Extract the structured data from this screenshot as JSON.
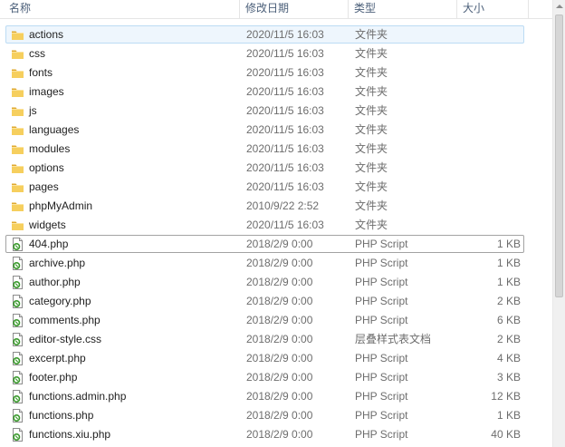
{
  "columns": {
    "name": "名称",
    "date": "修改日期",
    "type": "类型",
    "size": "大小"
  },
  "rows": [
    {
      "name": "actions",
      "date": "2020/11/5 16:03",
      "type": "文件夹",
      "size": "",
      "kind": "folder",
      "state": "selected"
    },
    {
      "name": "css",
      "date": "2020/11/5 16:03",
      "type": "文件夹",
      "size": "",
      "kind": "folder"
    },
    {
      "name": "fonts",
      "date": "2020/11/5 16:03",
      "type": "文件夹",
      "size": "",
      "kind": "folder"
    },
    {
      "name": "images",
      "date": "2020/11/5 16:03",
      "type": "文件夹",
      "size": "",
      "kind": "folder"
    },
    {
      "name": "js",
      "date": "2020/11/5 16:03",
      "type": "文件夹",
      "size": "",
      "kind": "folder"
    },
    {
      "name": "languages",
      "date": "2020/11/5 16:03",
      "type": "文件夹",
      "size": "",
      "kind": "folder"
    },
    {
      "name": "modules",
      "date": "2020/11/5 16:03",
      "type": "文件夹",
      "size": "",
      "kind": "folder"
    },
    {
      "name": "options",
      "date": "2020/11/5 16:03",
      "type": "文件夹",
      "size": "",
      "kind": "folder"
    },
    {
      "name": "pages",
      "date": "2020/11/5 16:03",
      "type": "文件夹",
      "size": "",
      "kind": "folder"
    },
    {
      "name": "phpMyAdmin",
      "date": "2010/9/22 2:52",
      "type": "文件夹",
      "size": "",
      "kind": "folder"
    },
    {
      "name": "widgets",
      "date": "2020/11/5 16:03",
      "type": "文件夹",
      "size": "",
      "kind": "folder"
    },
    {
      "name": "404.php",
      "date": "2018/2/9 0:00",
      "type": "PHP Script",
      "size": "1 KB",
      "kind": "script",
      "state": "focused"
    },
    {
      "name": "archive.php",
      "date": "2018/2/9 0:00",
      "type": "PHP Script",
      "size": "1 KB",
      "kind": "script"
    },
    {
      "name": "author.php",
      "date": "2018/2/9 0:00",
      "type": "PHP Script",
      "size": "1 KB",
      "kind": "script"
    },
    {
      "name": "category.php",
      "date": "2018/2/9 0:00",
      "type": "PHP Script",
      "size": "2 KB",
      "kind": "script"
    },
    {
      "name": "comments.php",
      "date": "2018/2/9 0:00",
      "type": "PHP Script",
      "size": "6 KB",
      "kind": "script"
    },
    {
      "name": "editor-style.css",
      "date": "2018/2/9 0:00",
      "type": "层叠样式表文档",
      "size": "2 KB",
      "kind": "script"
    },
    {
      "name": "excerpt.php",
      "date": "2018/2/9 0:00",
      "type": "PHP Script",
      "size": "4 KB",
      "kind": "script"
    },
    {
      "name": "footer.php",
      "date": "2018/2/9 0:00",
      "type": "PHP Script",
      "size": "3 KB",
      "kind": "script"
    },
    {
      "name": "functions.admin.php",
      "date": "2018/2/9 0:00",
      "type": "PHP Script",
      "size": "12 KB",
      "kind": "script"
    },
    {
      "name": "functions.php",
      "date": "2018/2/9 0:00",
      "type": "PHP Script",
      "size": "1 KB",
      "kind": "script"
    },
    {
      "name": "functions.xiu.php",
      "date": "2018/2/9 0:00",
      "type": "PHP Script",
      "size": "40 KB",
      "kind": "script"
    }
  ],
  "colors": {
    "selection_bg": "#eef6fd",
    "selection_border": "#bcdcf4",
    "folder": "#f2c24a",
    "script_accent": "#3a9a2c"
  }
}
